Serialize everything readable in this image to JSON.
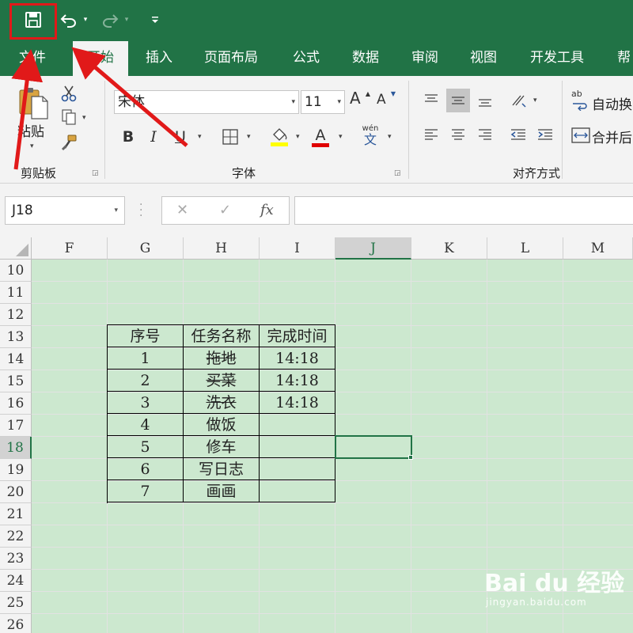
{
  "quick_access": {
    "save_icon": "save-icon",
    "undo_icon": "undo-icon",
    "redo_icon": "redo-icon",
    "dropdown_glyph": "▾"
  },
  "tabs": [
    {
      "label": "文件",
      "active": false
    },
    {
      "label": "开始",
      "active": true
    },
    {
      "label": "插入",
      "active": false
    },
    {
      "label": "页面布局",
      "active": false
    },
    {
      "label": "公式",
      "active": false
    },
    {
      "label": "数据",
      "active": false
    },
    {
      "label": "审阅",
      "active": false
    },
    {
      "label": "视图",
      "active": false
    },
    {
      "label": "开发工具",
      "active": false
    },
    {
      "label": "帮",
      "active": false
    }
  ],
  "ribbon": {
    "clipboard": {
      "group_label": "剪贴板",
      "paste_label": "粘贴"
    },
    "font": {
      "group_label": "字体",
      "font_name": "宋体",
      "font_size": "11",
      "grow_label": "A",
      "shrink_label": "A",
      "bold": "B",
      "italic": "I",
      "underline": "U",
      "font_color_glyph": "A",
      "phonetic_top": "wén",
      "phonetic_bottom": "文",
      "fill_color": "#ffff00",
      "font_color": "#e00000"
    },
    "alignment": {
      "group_label": "对齐方式",
      "wrap_label": "自动换",
      "merge_label": "合并后",
      "wrap_icon_text": "ab"
    }
  },
  "formula_bar": {
    "name_box": "J18",
    "cancel_glyph": "✕",
    "enter_glyph": "✓",
    "fx_glyph": "fx",
    "formula": ""
  },
  "sheet": {
    "columns": [
      "F",
      "G",
      "H",
      "I",
      "J",
      "K",
      "L",
      "M"
    ],
    "active_column": "J",
    "rows": [
      "10",
      "11",
      "12",
      "13",
      "14",
      "15",
      "16",
      "17",
      "18",
      "19",
      "20",
      "21",
      "22",
      "23",
      "24",
      "25",
      "26"
    ],
    "active_row": "18",
    "active_cell": "J18",
    "table": {
      "headers": [
        "序号",
        "任务名称",
        "完成时间"
      ],
      "rows": [
        {
          "no": "1",
          "task": "拖地",
          "time": "14:18",
          "done": true
        },
        {
          "no": "2",
          "task": "买菜",
          "time": "14:18",
          "done": true
        },
        {
          "no": "3",
          "task": "洗衣",
          "time": "14:18",
          "done": true
        },
        {
          "no": "4",
          "task": "做饭",
          "time": "",
          "done": false
        },
        {
          "no": "5",
          "task": "修车",
          "time": "",
          "done": false
        },
        {
          "no": "6",
          "task": "写日志",
          "time": "",
          "done": false
        },
        {
          "no": "7",
          "task": "画画",
          "time": "",
          "done": false
        }
      ]
    }
  },
  "colors": {
    "accent": "#217346",
    "sheet_bg": "#cce8cf",
    "annotation": "#e11919"
  },
  "watermark": {
    "main": "Bai du 经验",
    "sub": "jingyan.baidu.com"
  }
}
